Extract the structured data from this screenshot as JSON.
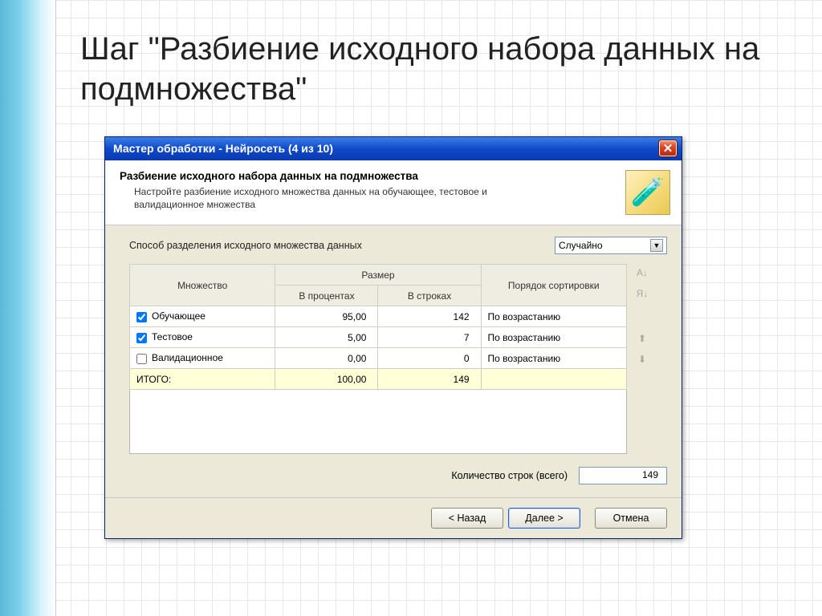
{
  "slide": {
    "title": "Шаг \"Разбиение исходного набора данных на подмножества\""
  },
  "window": {
    "title": "Мастер обработки - Нейросеть (4 из 10)",
    "close_glyph": "✕"
  },
  "header": {
    "title": "Разбиение исходного набора данных на подмножества",
    "subtitle": "Настройте разбиение исходного множества данных на обучающее, тестовое и валидационное множества",
    "icon_glyph": "🧪"
  },
  "split_method": {
    "label": "Способ разделения исходного множества данных",
    "value": "Случайно"
  },
  "table": {
    "col_set": "Множество",
    "col_size": "Размер",
    "col_pct": "В процентах",
    "col_rows": "В строках",
    "col_order": "Порядок сортировки",
    "rows": [
      {
        "checked": true,
        "name": "Обучающее",
        "pct": "95,00",
        "rows": "142",
        "order": "По возрастанию"
      },
      {
        "checked": true,
        "name": "Тестовое",
        "pct": "5,00",
        "rows": "7",
        "order": "По возрастанию"
      },
      {
        "checked": false,
        "name": "Валидационное",
        "pct": "0,00",
        "rows": "0",
        "order": "По возрастанию"
      }
    ],
    "total_label": "ИТОГО:",
    "total_pct": "100,00",
    "total_rows": "149"
  },
  "total_count": {
    "label": "Количество строк (всего)",
    "value": "149"
  },
  "buttons": {
    "back": "< Назад",
    "next": "Далее >",
    "cancel": "Отмена"
  },
  "side_glyphs": {
    "sort_asc": "A↓",
    "sort_desc": "Я↓",
    "up": "⬆",
    "down": "⬇"
  }
}
